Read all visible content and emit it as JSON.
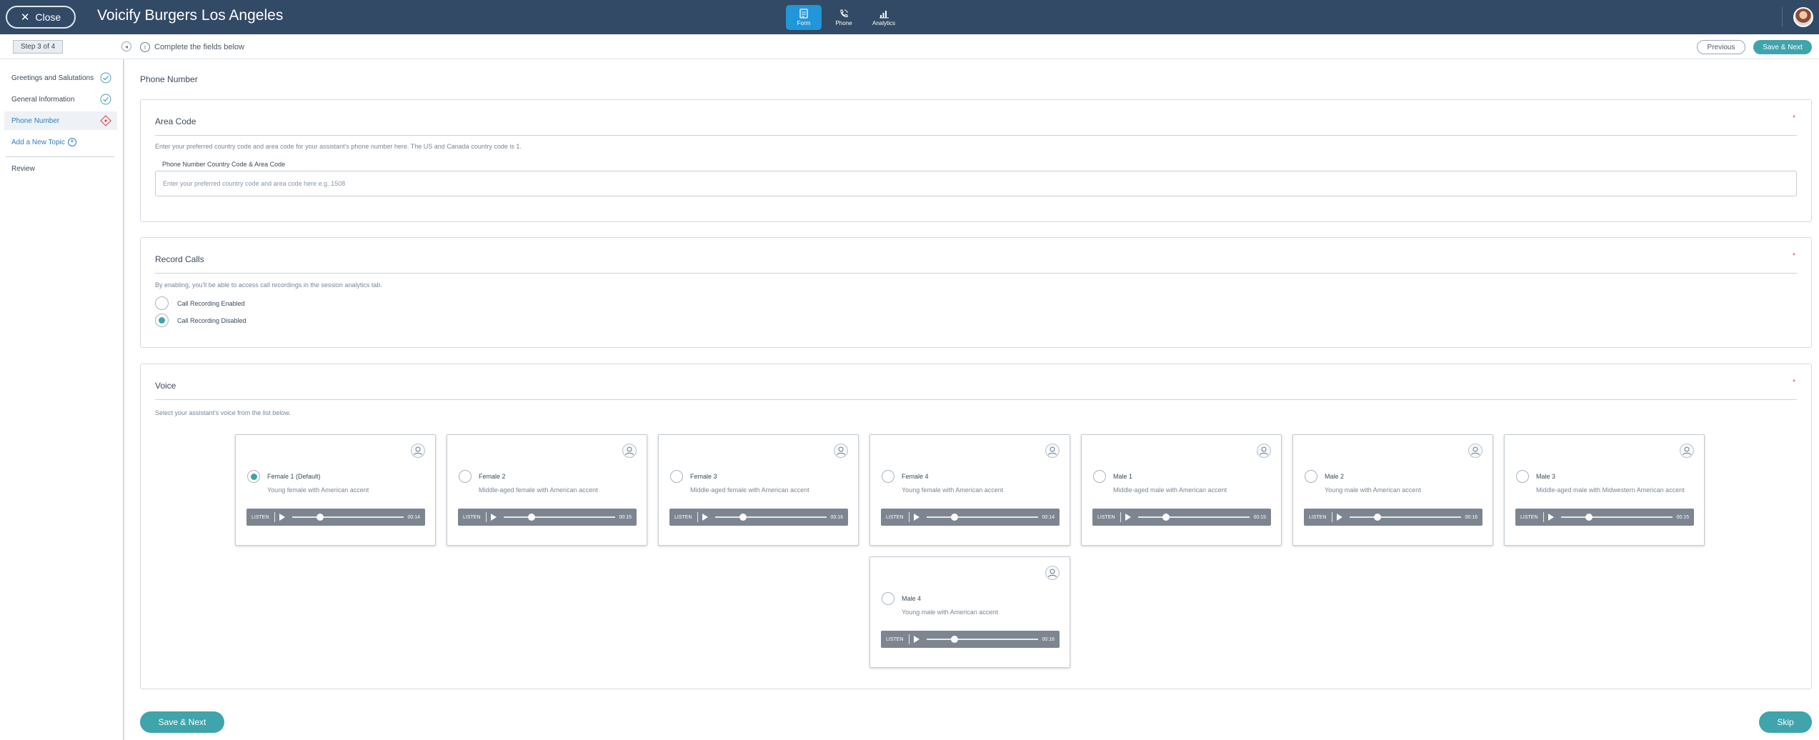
{
  "header": {
    "close_label": "Close",
    "app_title": "Voicify Burgers Los Angeles",
    "nav": [
      {
        "label": "Form",
        "icon": "form-icon"
      },
      {
        "label": "Phone",
        "icon": "phone-icon"
      },
      {
        "label": "Analytics",
        "icon": "analytics-icon"
      }
    ]
  },
  "subbar": {
    "step": "Step 3 of 4",
    "info": "Complete the fields below",
    "previous_label": "Previous",
    "save_next_label": "Save & Next"
  },
  "sidebar": {
    "items": [
      {
        "label": "Greetings and Salutations",
        "status": "complete"
      },
      {
        "label": "General Information",
        "status": "complete"
      },
      {
        "label": "Phone Number",
        "status": "incomplete"
      }
    ],
    "add_topic": "Add a New Topic",
    "review": "Review"
  },
  "main": {
    "heading": "Phone Number",
    "area_code": {
      "title": "Area Code",
      "required": "*",
      "description": "Enter your preferred country code and area code for your assistant's phone number here. The US and Canada country code is 1.",
      "field_label": "Phone Number Country Code & Area Code",
      "placeholder": "Enter your preferred country code and area code here e.g. 1508",
      "value": ""
    },
    "record_calls": {
      "title": "Record Calls",
      "required": "*",
      "description": "By enabling, you'll be able to access call recordings in the session analytics tab.",
      "options": [
        {
          "label": "Call Recording Enabled",
          "selected": false
        },
        {
          "label": "Call Recording Disabled",
          "selected": true
        }
      ]
    },
    "voice": {
      "title": "Voice",
      "required": "*",
      "description": "Select your assistant's voice from the list below.",
      "listen_label": "LISTEN",
      "cards": [
        {
          "name": "Female 1 (Default)",
          "desc": "Young female with American accent",
          "duration": "00:14",
          "selected": true
        },
        {
          "name": "Female 2",
          "desc": "Middle-aged female with American accent",
          "duration": "00:15",
          "selected": false
        },
        {
          "name": "Female 3",
          "desc": "Middle-aged female with American accent",
          "duration": "00:16",
          "selected": false
        },
        {
          "name": "Female 4",
          "desc": "Young female with American accent",
          "duration": "00:14",
          "selected": false
        },
        {
          "name": "Male 1",
          "desc": "Middle-aged male with American accent",
          "duration": "00:15",
          "selected": false
        },
        {
          "name": "Male 2",
          "desc": "Young male with American accent",
          "duration": "00:16",
          "selected": false
        },
        {
          "name": "Male 3",
          "desc": "Middle-aged male with Midwestern American accent",
          "duration": "00:15",
          "selected": false
        },
        {
          "name": "Male 4",
          "desc": "Young male with American accent",
          "duration": "00:16",
          "selected": false
        }
      ]
    }
  },
  "footer": {
    "save_next_label": "Save & Next",
    "skip_label": "Skip"
  },
  "colors": {
    "header_bg": "#324a66",
    "accent": "#3fa4ac",
    "nav_active": "#2196d9",
    "required": "#e0454b"
  }
}
